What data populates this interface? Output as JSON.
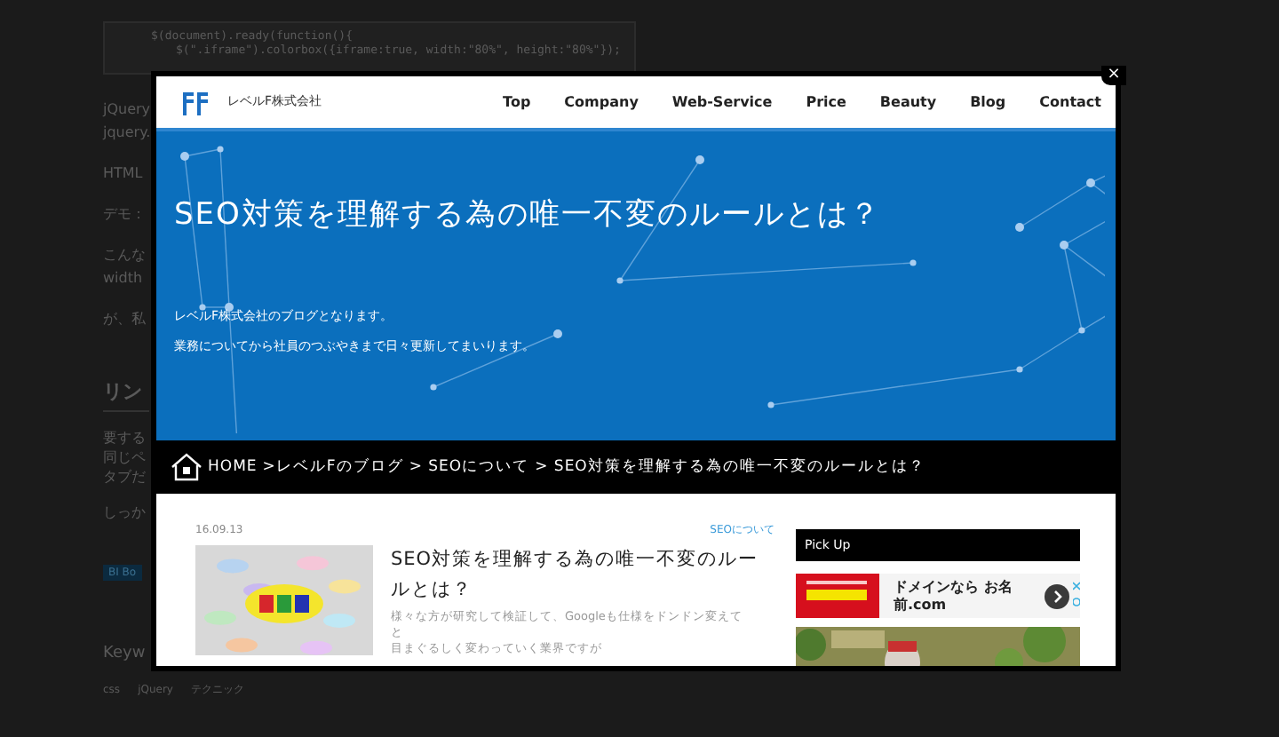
{
  "background": {
    "code_lines": [
      "$(document).ready(function(){",
      "$(\".iframe\").colorbox({iframe:true, width:\"80%\", height:\"80%\"});"
    ],
    "fragments": [
      "jQuery",
      "jquery.",
      "HTML",
      "デモ：",
      "こんな",
      "width",
      "が、私"
    ],
    "heading": "リン",
    "fragments_2": [
      "要する",
      "同じペ",
      "タブだ",
      "しっか"
    ],
    "button": "BI Bo",
    "keywords_heading": "Keyw",
    "tags": [
      "css",
      "jQuery",
      "テクニック"
    ]
  },
  "modal": {
    "close": "×",
    "brand": "レベルF株式会社",
    "nav": [
      "Top",
      "Company",
      "Web-Service",
      "Price",
      "Beauty",
      "Blog",
      "Contact"
    ],
    "hero": {
      "title": "SEO対策を理解する為の唯一不変のルールとは？",
      "lines": [
        "レベルF株式会社のブログとなります。",
        "業務についてから社員のつぶやきまで日々更新してまいります。"
      ]
    },
    "breadcrumb": [
      "HOME",
      ">レベルFのブログ",
      "> SEOについて",
      "> SEO対策を理解する為の唯一不変のルールとは？"
    ],
    "post": {
      "date": "16.09.13",
      "category": "SEOについて",
      "title": "SEO対策を理解する為の唯一不変のルールとは？",
      "excerpt": [
        "様々な方が研究して検証して、Googleも仕様をドンドン変えて",
        "と",
        "目まぐるしく変わっていく業界ですが"
      ]
    },
    "sidebar": {
      "heading": "Pick Up",
      "ad_text": "ドメインなら お名前.com"
    }
  }
}
